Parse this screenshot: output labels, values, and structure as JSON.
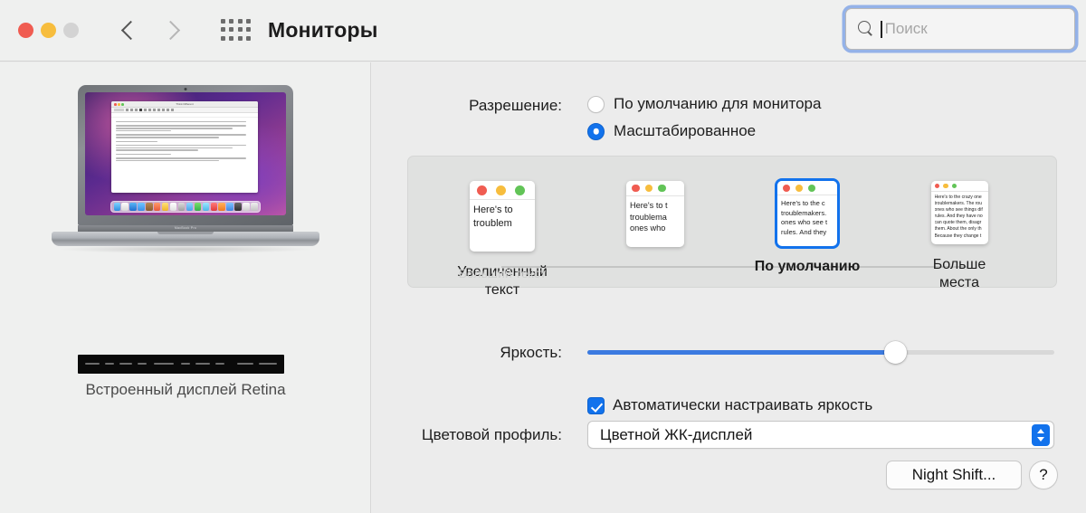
{
  "window": {
    "title": "Мониторы",
    "traffic_lights": [
      "close-red",
      "minimize-yellow",
      "zoom-disabled-grey"
    ]
  },
  "toolbar": {
    "back_icon": "chevron-left-icon",
    "forward_icon": "chevron-right-icon",
    "grid_icon": "show-all-grid-icon",
    "title": "Мониторы"
  },
  "search": {
    "icon": "search-icon",
    "placeholder": "Поиск",
    "value": "",
    "focused": true,
    "focus_ring_color": "#7aa0e6"
  },
  "left_pane": {
    "display_label": "Встроенный дисплей Retina",
    "device": "MacBook Pro",
    "device_badge": "MacBook Pro",
    "touchbar": "touch-bar-strip"
  },
  "resolution": {
    "label": "Разрешение:",
    "options": [
      {
        "label": "По умолчанию для монитора",
        "selected": false
      },
      {
        "label": "Масштабированное",
        "selected": true
      }
    ],
    "accent_color": "#1272ec"
  },
  "scaled": {
    "options": [
      {
        "label": "Увеличенный\nтекст",
        "label_line1": "Увеличенный",
        "label_line2": "текст",
        "ghost_label": "Больший текст",
        "selected": false,
        "preview_lines": [
          "Here's to",
          "troublem"
        ]
      },
      {
        "label": "",
        "label_line1": "",
        "label_line2": "",
        "selected": false,
        "preview_lines": [
          "Here's to t",
          "troublema",
          "ones who"
        ]
      },
      {
        "label": "По умолчанию",
        "label_line1": "По умолчанию",
        "label_line2": "",
        "selected": true,
        "preview_lines": [
          "Here's to the c",
          "troublemakers.",
          "ones who see t",
          "rules. And they"
        ]
      },
      {
        "label": "Больше\nместа",
        "label_line1": "Больше",
        "label_line2": "места",
        "selected": false,
        "preview_lines": [
          "Here's to the crazy one",
          "troublemakers. The rou",
          "ones who see things dif",
          "rules. And they have no",
          "can quote them, disagr",
          "them. About the only th",
          "Because they change t"
        ]
      }
    ]
  },
  "brightness": {
    "label": "Яркость:",
    "value_percent": 66,
    "fill_color": "#3b7ae0"
  },
  "auto_brightness": {
    "label": "Автоматически настраивать яркость",
    "checked": true
  },
  "color_profile": {
    "label": "Цветовой профиль:",
    "value": "Цветной ЖК-дисплей",
    "stepper_icon": "chevron-up-down-icon"
  },
  "buttons": {
    "night_shift": "Night Shift...",
    "help": "?"
  }
}
